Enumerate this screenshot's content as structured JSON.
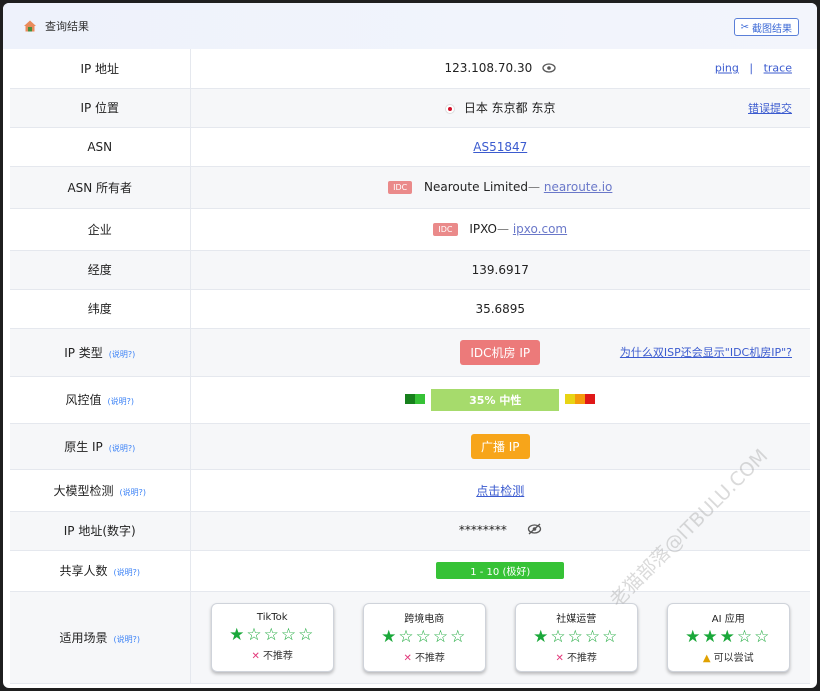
{
  "header": {
    "title": "查询结果",
    "screenshot_label": "截图结果"
  },
  "rows": {
    "ip": {
      "label": "IP 地址",
      "value": "123.108.70.30",
      "ping": "ping",
      "sep": "|",
      "trace": "trace"
    },
    "location": {
      "label": "IP 位置",
      "value": "日本 东京都 东京",
      "report": "错误提交"
    },
    "asn": {
      "label": "ASN",
      "value": "AS51847"
    },
    "asn_owner": {
      "label": "ASN 所有者",
      "tag": "IDC",
      "name": "Nearoute Limited",
      "dash": "—",
      "domain": "nearoute.io"
    },
    "company": {
      "label": "企业",
      "tag": "IDC",
      "name": "IPXO",
      "dash": "—",
      "domain": "ipxo.com"
    },
    "longitude": {
      "label": "经度",
      "value": "139.6917"
    },
    "latitude": {
      "label": "纬度",
      "value": "35.6895"
    },
    "ip_type": {
      "label": "IP 类型",
      "hint": "(说明?)",
      "value": "IDC机房 IP",
      "question": "为什么双ISP还会显示\"IDC机房IP\"?"
    },
    "risk": {
      "label": "风控值",
      "hint": "(说明?)",
      "value": "35%  中性",
      "percent": 35
    },
    "native": {
      "label": "原生 IP",
      "hint": "(说明?)",
      "value": "广播 IP"
    },
    "llm": {
      "label": "大模型检测",
      "hint": "(说明?)",
      "value": "点击检测"
    },
    "ip_numeric": {
      "label": "IP 地址(数字)",
      "value": "********"
    },
    "shared": {
      "label": "共享人数",
      "hint": "(说明?)",
      "value": "1 - 10 (极好)"
    },
    "scenes": {
      "label": "适用场景",
      "hint": "(说明?)"
    }
  },
  "scenes": [
    {
      "name": "TikTok",
      "stars": "★☆☆☆☆",
      "rating": 1,
      "verdict": "不推荐"
    },
    {
      "name": "跨境电商",
      "stars": "★☆☆☆☆",
      "rating": 1,
      "verdict": "不推荐"
    },
    {
      "name": "社媒运营",
      "stars": "★☆☆☆☆",
      "rating": 1,
      "verdict": "不推荐"
    },
    {
      "name": "AI 应用",
      "stars": "★★★☆☆",
      "rating": 3,
      "verdict": "可以尝试"
    }
  ],
  "watermark": "老猫部落@ITBULU.COM",
  "colors": {
    "idc_red": "#ec7a7a",
    "broadcast_orange": "#f7a51a",
    "risk_green": "#a6db6c",
    "share_green": "#36c236",
    "star_green": "#1aa83a",
    "link_blue": "#3b5bcf"
  },
  "icons": {
    "header": "home-icon",
    "screenshot": "scissors-icon",
    "ip_eye": "eye-icon",
    "numeric_eye": "eye-off-icon",
    "flag": "japan-flag-icon"
  }
}
